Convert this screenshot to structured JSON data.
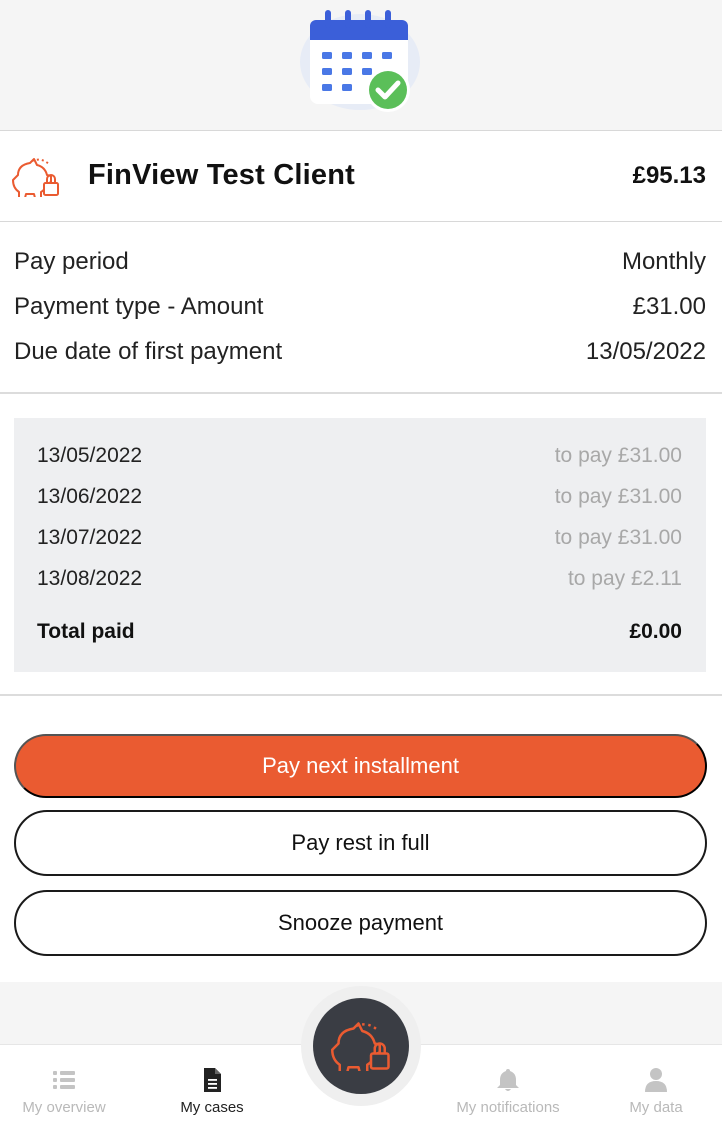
{
  "header": {
    "icon": "calendar-check-icon"
  },
  "client": {
    "icon": "piggy-bank-lock-icon",
    "name": "FinView Test Client",
    "amount": "£95.13"
  },
  "details": [
    {
      "label": "Pay period",
      "value": "Monthly"
    },
    {
      "label": "Payment type - Amount",
      "value": "£31.00"
    },
    {
      "label": "Due date of first payment",
      "value": "13/05/2022"
    }
  ],
  "schedule": {
    "items": [
      {
        "date": "13/05/2022",
        "status": "to pay £31.00"
      },
      {
        "date": "13/06/2022",
        "status": "to pay £31.00"
      },
      {
        "date": "13/07/2022",
        "status": "to pay £31.00"
      },
      {
        "date": "13/08/2022",
        "status": "to pay £2.11"
      }
    ],
    "total_label": "Total paid",
    "total_value": "£0.00"
  },
  "actions": {
    "pay_next": "Pay next installment",
    "pay_rest": "Pay rest in full",
    "snooze": "Snooze payment"
  },
  "nav": {
    "items": [
      {
        "label": "My overview",
        "icon": "list-icon",
        "active": false
      },
      {
        "label": "My cases",
        "icon": "document-icon",
        "active": true
      },
      {
        "label": "My notifications",
        "icon": "bell-icon",
        "active": false
      },
      {
        "label": "My data",
        "icon": "user-icon",
        "active": false
      }
    ],
    "fab_icon": "piggy-bank-lock-icon"
  },
  "colors": {
    "accent": "#ea5b31",
    "fab": "#3a3d44",
    "muted_text": "#a8a8a8",
    "schedule_bg": "#eeeff1"
  }
}
